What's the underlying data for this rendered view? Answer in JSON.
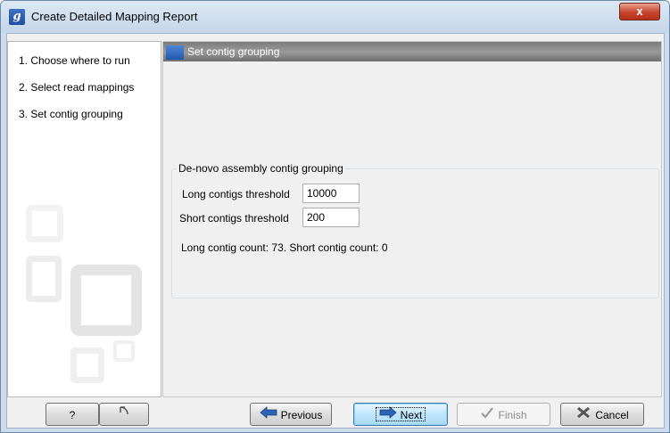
{
  "window": {
    "app_icon_letter": "g",
    "title": "Create Detailed Mapping Report",
    "close_label": "x"
  },
  "steps": [
    {
      "label": "1. Choose where to run"
    },
    {
      "label": "2. Select read mappings"
    },
    {
      "label": "3. Set contig grouping"
    }
  ],
  "panel": {
    "header": "Set contig grouping",
    "group_title": "De-novo assembly contig grouping",
    "long_label": "Long contigs threshold",
    "long_value": "10000",
    "short_label": "Short contigs threshold",
    "short_value": "200",
    "count_text": "Long contig count: 73. Short contig count: 0"
  },
  "buttons": {
    "help": "?",
    "previous": "Previous",
    "next": "Next",
    "finish": "Finish",
    "cancel": "Cancel"
  },
  "icons": {
    "help": "help-icon",
    "reset": "reset-arrow-icon",
    "previous": "arrow-left-icon",
    "next": "arrow-right-icon",
    "finish": "checkmark-icon",
    "cancel": "cancel-x-icon"
  }
}
